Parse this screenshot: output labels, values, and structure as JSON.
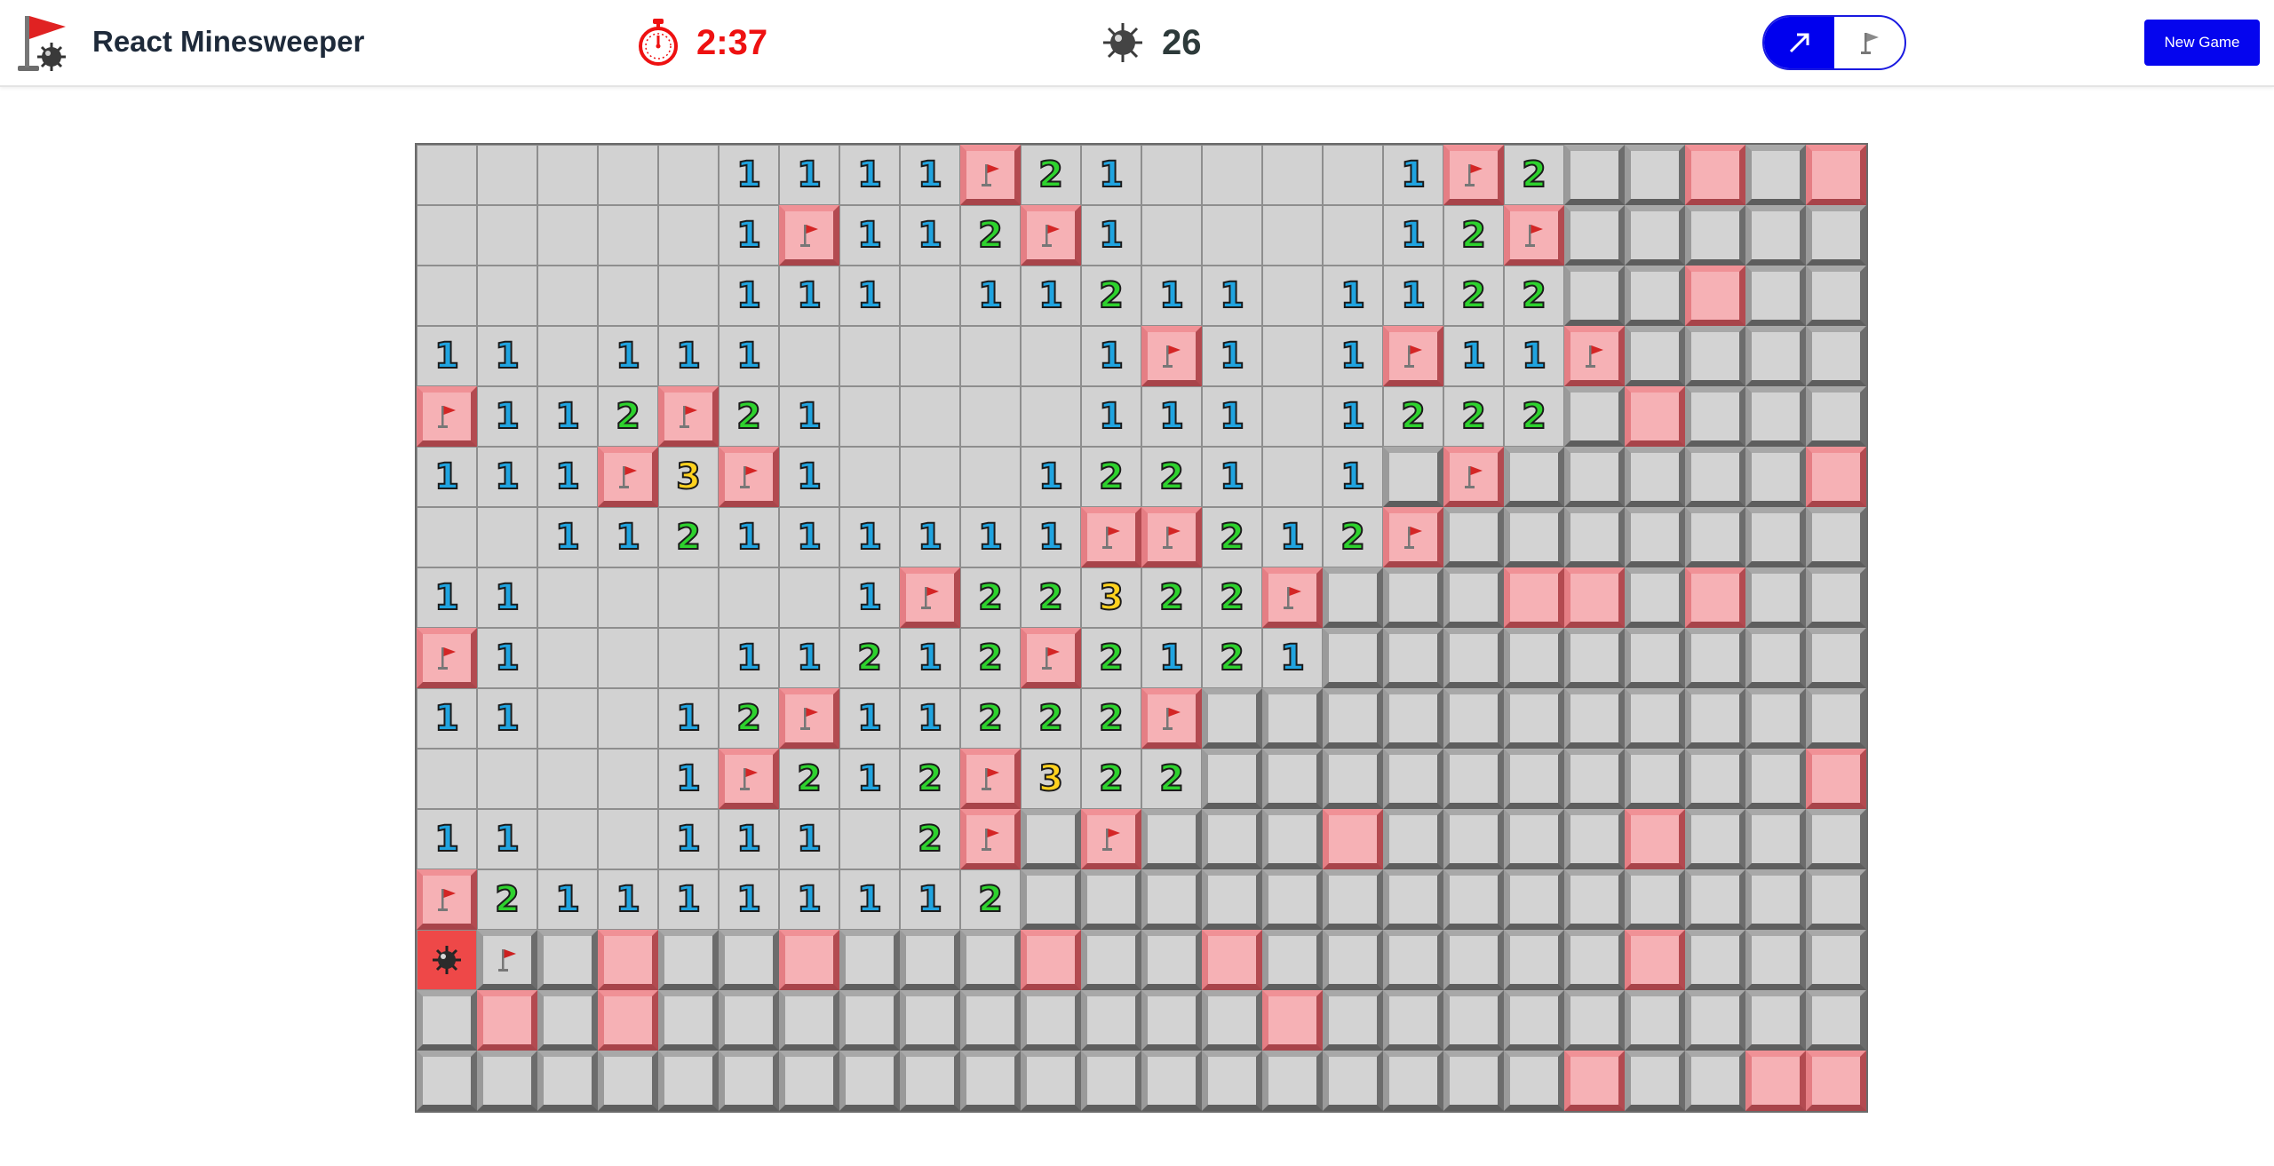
{
  "app": {
    "title": "React Minesweeper",
    "logo_icon": "flag-mine-logo-icon"
  },
  "status": {
    "timer_icon": "stopwatch-icon",
    "time": "2:37",
    "mine_icon": "mine-icon",
    "mines_remaining": "26"
  },
  "mode_toggle": {
    "active": "reveal",
    "options": [
      {
        "name": "reveal",
        "icon": "cursor-arrow-icon"
      },
      {
        "name": "flag",
        "icon": "flag-icon"
      }
    ]
  },
  "new_game_label": "New Game",
  "colors": {
    "accent": "#0000EE",
    "timer": "#EE1111",
    "one": "#20A4E0",
    "two": "#2ED22E",
    "three": "#FFD21E",
    "flagged_tile": "#F6B1B5",
    "exploded_tile": "#EE4848"
  },
  "legend": {
    "0": "revealed empty",
    "1-3": "revealed number",
    "F": "flag on revealed area",
    "P": "pink tile",
    "H": "hidden tile",
    "X": "exploded mine",
    "G": "grey flag on hidden tile"
  },
  "board": {
    "rows": 16,
    "cols": 24,
    "grid": [
      [
        "0",
        "0",
        "0",
        "0",
        "0",
        "1",
        "1",
        "1",
        "1",
        "P",
        "2",
        "1",
        "0",
        "0",
        "0",
        "0",
        "1",
        "P",
        "2",
        "H",
        "H",
        "P",
        "H",
        "P"
      ],
      [
        "0",
        "0",
        "0",
        "0",
        "0",
        "1",
        "P",
        "1",
        "1",
        "2",
        "P",
        "1",
        "0",
        "0",
        "0",
        "0",
        "1",
        "2",
        "P",
        "H",
        "H",
        "H",
        "H",
        "H"
      ],
      [
        "0",
        "0",
        "0",
        "0",
        "0",
        "1",
        "1",
        "1",
        "0",
        "1",
        "1",
        "2",
        "1",
        "1",
        "0",
        "1",
        "1",
        "2",
        "2",
        "H",
        "H",
        "P",
        "H",
        "H"
      ],
      [
        "1",
        "1",
        "0",
        "1",
        "1",
        "1",
        "0",
        "0",
        "0",
        "0",
        "0",
        "1",
        "P",
        "1",
        "0",
        "1",
        "P",
        "1",
        "1",
        "P",
        "H",
        "H",
        "H",
        "H"
      ],
      [
        "P",
        "1",
        "1",
        "2",
        "P",
        "2",
        "1",
        "0",
        "0",
        "0",
        "0",
        "1",
        "1",
        "1",
        "0",
        "1",
        "2",
        "2",
        "2",
        "H",
        "P",
        "H",
        "H",
        "H"
      ],
      [
        "1",
        "1",
        "1",
        "P",
        "3",
        "P",
        "1",
        "0",
        "0",
        "0",
        "1",
        "2",
        "2",
        "1",
        "0",
        "1",
        "H",
        "P",
        "H",
        "H",
        "H",
        "H",
        "H",
        "P"
      ],
      [
        "0",
        "0",
        "1",
        "1",
        "2",
        "1",
        "1",
        "1",
        "1",
        "1",
        "1",
        "P",
        "P",
        "2",
        "1",
        "2",
        "P",
        "H",
        "H",
        "H",
        "H",
        "H",
        "H",
        "H"
      ],
      [
        "1",
        "1",
        "0",
        "0",
        "0",
        "0",
        "0",
        "1",
        "P",
        "2",
        "2",
        "3",
        "2",
        "2",
        "P",
        "H",
        "H",
        "H",
        "P",
        "P",
        "H",
        "P",
        "H",
        "H"
      ],
      [
        "P",
        "1",
        "0",
        "0",
        "0",
        "1",
        "1",
        "2",
        "1",
        "2",
        "P",
        "2",
        "1",
        "2",
        "1",
        "H",
        "H",
        "H",
        "H",
        "H",
        "H",
        "H",
        "H",
        "H"
      ],
      [
        "1",
        "1",
        "0",
        "0",
        "1",
        "2",
        "P",
        "1",
        "1",
        "2",
        "2",
        "2",
        "P",
        "H",
        "H",
        "H",
        "H",
        "H",
        "H",
        "H",
        "H",
        "H",
        "H",
        "H"
      ],
      [
        "0",
        "0",
        "0",
        "0",
        "1",
        "P",
        "2",
        "1",
        "2",
        "P",
        "3",
        "2",
        "2",
        "H",
        "H",
        "H",
        "H",
        "H",
        "H",
        "H",
        "H",
        "H",
        "H",
        "P"
      ],
      [
        "1",
        "1",
        "0",
        "0",
        "1",
        "1",
        "1",
        "0",
        "2",
        "P",
        "H",
        "P",
        "H",
        "H",
        "H",
        "P",
        "H",
        "H",
        "H",
        "H",
        "P",
        "H",
        "H",
        "H"
      ],
      [
        "P",
        "2",
        "1",
        "1",
        "1",
        "1",
        "1",
        "1",
        "1",
        "2",
        "H",
        "H",
        "H",
        "H",
        "H",
        "H",
        "H",
        "H",
        "H",
        "H",
        "H",
        "H",
        "H",
        "H"
      ],
      [
        "X",
        "G",
        "H",
        "P",
        "H",
        "H",
        "P",
        "H",
        "H",
        "H",
        "P",
        "H",
        "H",
        "P",
        "H",
        "H",
        "H",
        "H",
        "H",
        "H",
        "P",
        "H",
        "H",
        "H"
      ],
      [
        "H",
        "P",
        "H",
        "P",
        "H",
        "H",
        "H",
        "H",
        "H",
        "H",
        "H",
        "H",
        "H",
        "H",
        "P",
        "H",
        "H",
        "H",
        "H",
        "H",
        "H",
        "H",
        "H",
        "H"
      ],
      [
        "H",
        "H",
        "H",
        "H",
        "H",
        "H",
        "H",
        "H",
        "H",
        "H",
        "H",
        "H",
        "H",
        "H",
        "H",
        "H",
        "H",
        "H",
        "H",
        "P",
        "H",
        "H",
        "P",
        "P"
      ]
    ]
  }
}
